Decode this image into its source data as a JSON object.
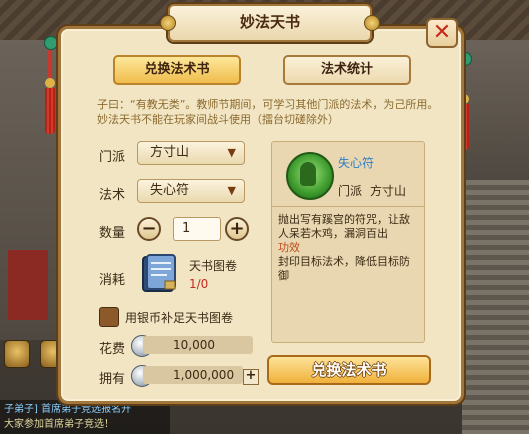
{
  "window": {
    "title": "妙法天书",
    "close_icon": "close-icon"
  },
  "tabs": [
    {
      "label": "兑换法术书",
      "active": true
    },
    {
      "label": "法术统计",
      "active": false
    }
  ],
  "description": "子曰：“有教无类”。教师节期间，可学习其他门派的法术，为己所用。妙法天书不能在玩家间战斗使用（擂台切磋除外）",
  "form": {
    "sect_label": "门派",
    "sect_value": "方寸山",
    "spell_label": "法术",
    "spell_value": "失心符",
    "qty_label": "数量",
    "qty_value": "1",
    "consume_label": "消耗",
    "item_name": "天书图卷",
    "item_count": "1/0",
    "checkbox_label": "用银币补足天书图卷",
    "cost_label": "花费",
    "cost_value": "10,000",
    "own_label": "拥有",
    "own_value": "1,000,000"
  },
  "skill_card": {
    "name": "失心符",
    "sect_label": "门派",
    "sect_value": "方寸山",
    "desc_lines": [
      "抛出写有蹊宫的符咒，让敌人呆若木鸡，漏洞百出",
      "功效",
      "封印目标法术，降低目标防御"
    ]
  },
  "exchange_button": "兑换法术书",
  "chat": {
    "line1": "子弟子] 首席弟子竞选报名开",
    "line2": "大家参加首席弟子竞选！"
  },
  "colors": {
    "accent": "#f0bc4c",
    "panel": "#f1e5c4",
    "warning": "#c42b1f",
    "skill_name": "#2f7fc8"
  }
}
